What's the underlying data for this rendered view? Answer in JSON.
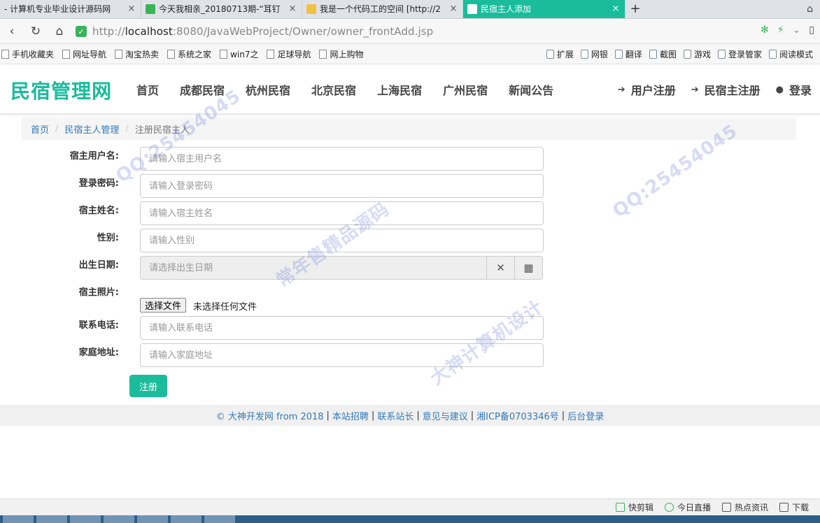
{
  "browser": {
    "tabs": [
      {
        "title": "- 计算机专业毕业设计源码网",
        "icon_color": "#ffffff"
      },
      {
        "title": "今天我相亲_20180713期-“耳钉",
        "icon_color": "#3bb35b"
      },
      {
        "title": "我是一个代码工的空间 [http://2",
        "icon_color": "#f0c040"
      },
      {
        "title": "民宿主人添加",
        "icon_color": "#ffffff"
      }
    ],
    "new_tab_label": "+",
    "url_prefix": "http://",
    "url_host": "localhost",
    "url_path": ":8080/JavaWebProject/Owner/owner_frontAdd.jsp",
    "bookmarks_left": [
      "手机收藏夹",
      "网址导航",
      "淘宝热卖",
      "系统之家",
      "win7之",
      "足球导航",
      "网上购物"
    ],
    "bookmarks_right": [
      "扩展",
      "网银",
      "翻译",
      "截图",
      "游戏",
      "登录管家",
      "阅读模式"
    ]
  },
  "site": {
    "logo": "民宿管理网",
    "nav": [
      "首页",
      "成都民宿",
      "杭州民宿",
      "北京民宿",
      "上海民宿",
      "广州民宿",
      "新闻公告"
    ],
    "right_nav": [
      {
        "label": "用户注册",
        "icon": "sign-in-icon"
      },
      {
        "label": "民宿主注册",
        "icon": "sign-in-icon"
      },
      {
        "label": "登录",
        "icon": "user-icon"
      }
    ]
  },
  "breadcrumb": {
    "home": "首页",
    "section": "民宿主人管理",
    "current": "注册民宿主人"
  },
  "form": {
    "username": {
      "label": "宿主用户名:",
      "placeholder": "请输入宿主用户名"
    },
    "password": {
      "label": "登录密码:",
      "placeholder": "请输入登录密码"
    },
    "name": {
      "label": "宿主姓名:",
      "placeholder": "请输入宿主姓名"
    },
    "gender": {
      "label": "性别:",
      "placeholder": "请输入性别"
    },
    "birthday": {
      "label": "出生日期:",
      "placeholder": "请选择出生日期"
    },
    "photo": {
      "label": "宿主照片:",
      "button": "选择文件",
      "status": "未选择任何文件"
    },
    "phone": {
      "label": "联系电话:",
      "placeholder": "请输入联系电话"
    },
    "address": {
      "label": "家庭地址:",
      "placeholder": "请输入家庭地址"
    },
    "submit": "注册"
  },
  "footer": {
    "copyright": "© 大神开发网 from 2018",
    "links": [
      "本站招聘",
      "联系站长",
      "意见与建议",
      "湘ICP备0703346号",
      "后台登录"
    ]
  },
  "statusbar": [
    "快剪辑",
    "今日直播",
    "热点资讯",
    "下载"
  ],
  "watermark": {
    "texts": [
      "QQ:25454045",
      "常年售精品源码",
      "大神计算机设计",
      "QQ:25454045"
    ]
  },
  "colors": {
    "accent": "#1abc9c",
    "link": "#337ab7"
  }
}
